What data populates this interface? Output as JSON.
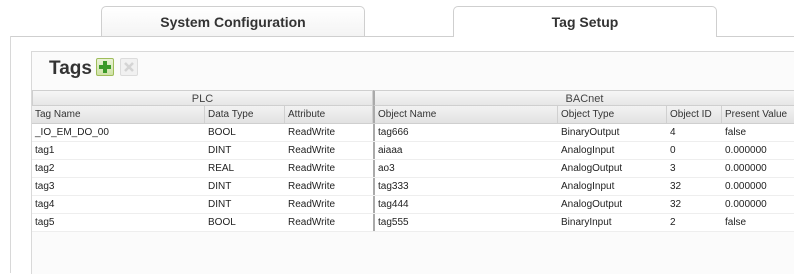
{
  "tabs": [
    {
      "label": "System Configuration",
      "active": false
    },
    {
      "label": "Tag Setup",
      "active": true
    }
  ],
  "panel": {
    "title": "Tags",
    "add_icon": "plus-icon",
    "delete_icon": "x-icon"
  },
  "grid": {
    "groups": [
      "PLC",
      "BACnet"
    ],
    "columns": [
      "Tag Name",
      "Data Type",
      "Attribute",
      "Object Name",
      "Object Type",
      "Object ID",
      "Present Value"
    ],
    "rows": [
      [
        "_IO_EM_DO_00",
        "BOOL",
        "ReadWrite",
        "tag666",
        "BinaryOutput",
        "4",
        "false"
      ],
      [
        "tag1",
        "DINT",
        "ReadWrite",
        "aiaaa",
        "AnalogInput",
        "0",
        "0.000000"
      ],
      [
        "tag2",
        "REAL",
        "ReadWrite",
        "ao3",
        "AnalogOutput",
        "3",
        "0.000000"
      ],
      [
        "tag3",
        "DINT",
        "ReadWrite",
        "tag333",
        "AnalogInput",
        "32",
        "0.000000"
      ],
      [
        "tag4",
        "DINT",
        "ReadWrite",
        "tag444",
        "AnalogOutput",
        "32",
        "0.000000"
      ],
      [
        "tag5",
        "BOOL",
        "ReadWrite",
        "tag555",
        "BinaryInput",
        "2",
        "false"
      ]
    ]
  },
  "colors": {
    "add_green": "#3c9a2a",
    "separator": "#aaaaaa"
  }
}
